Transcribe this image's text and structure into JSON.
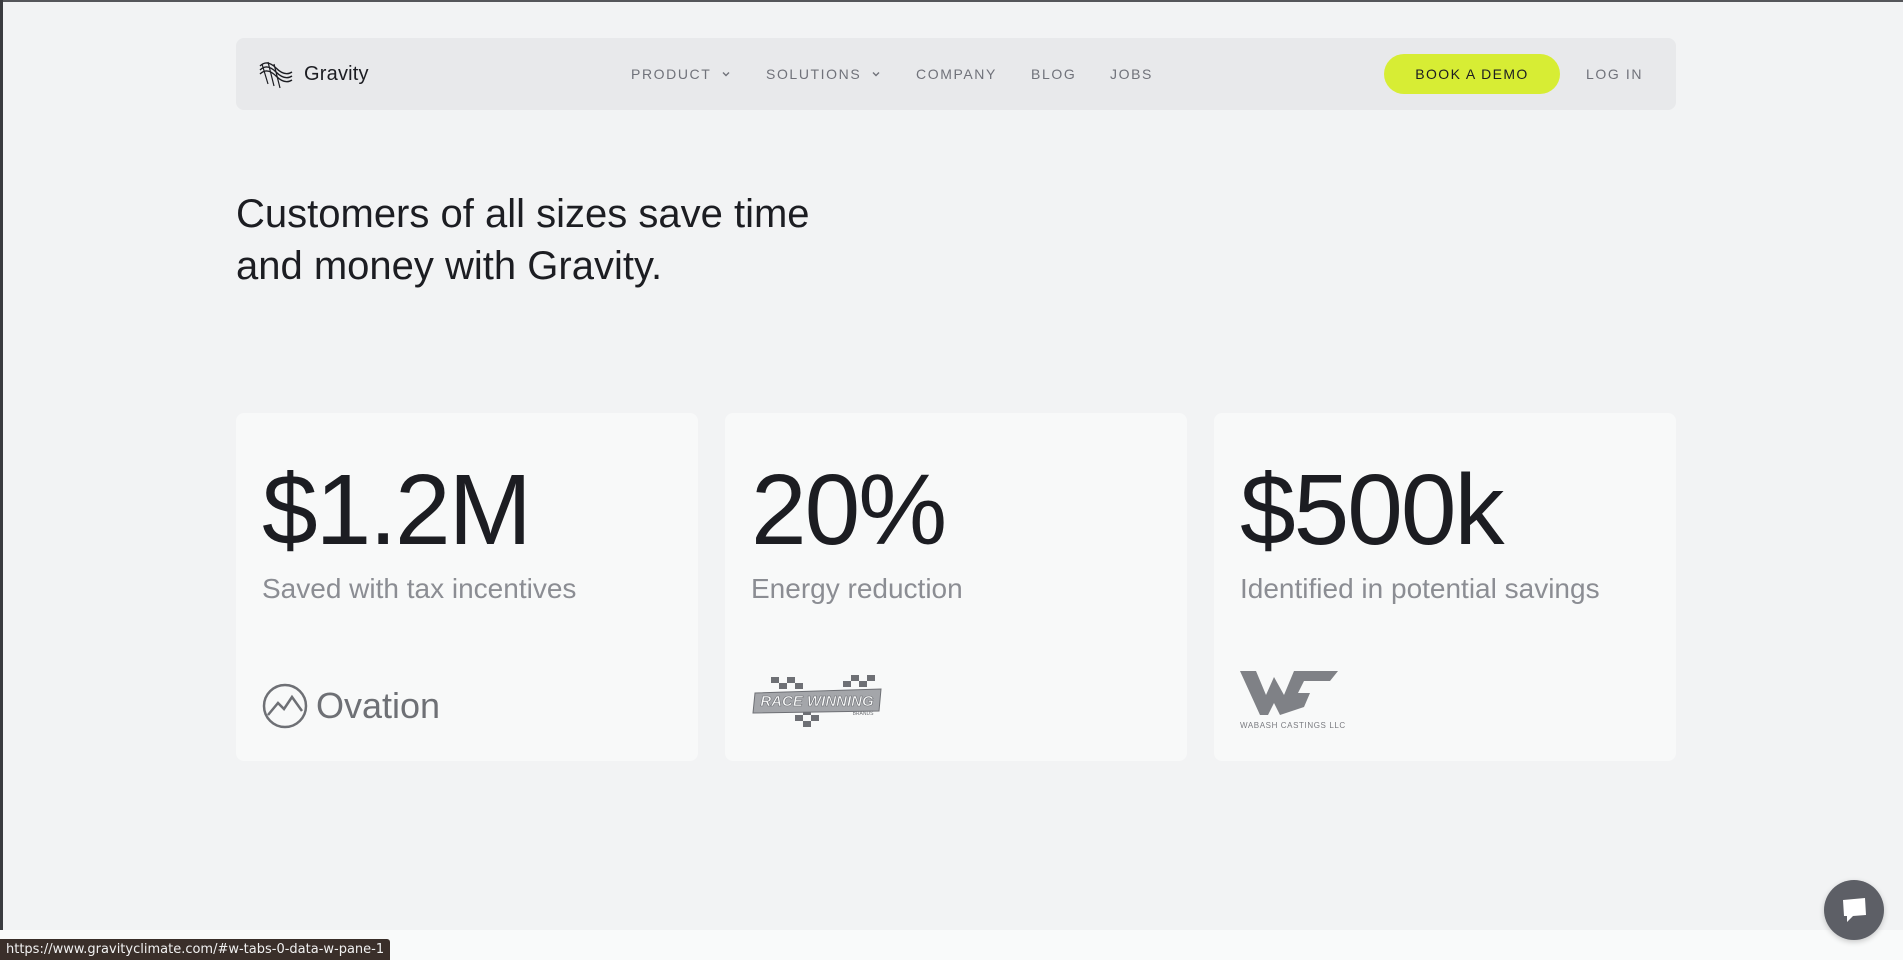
{
  "nav": {
    "brand": "Gravity",
    "items": [
      {
        "label": "PRODUCT",
        "has_dropdown": true
      },
      {
        "label": "SOLUTIONS",
        "has_dropdown": true
      },
      {
        "label": "COMPANY",
        "has_dropdown": false
      },
      {
        "label": "BLOG",
        "has_dropdown": false
      },
      {
        "label": "JOBS",
        "has_dropdown": false
      }
    ],
    "cta_label": "BOOK A DEMO",
    "login_label": "LOG IN",
    "cta_color": "#d7ed34"
  },
  "hero": {
    "line1": "Customers of all sizes save time",
    "line2": "and money with Gravity."
  },
  "cards": [
    {
      "stat": "$1.2M",
      "description": "Saved with tax incentives",
      "brand": "Ovation"
    },
    {
      "stat": "20%",
      "description": "Energy reduction",
      "brand": "RACE WINNING",
      "brand_sub": "BRANDS"
    },
    {
      "stat": "$500k",
      "description": "Identified in potential savings",
      "brand": "WABASH CASTINGS LLC"
    }
  ],
  "status_url": "https://www.gravityclimate.com/#w-tabs-0-data-w-pane-1",
  "icons": {
    "logo": "gravity-wave-icon",
    "dropdown": "chevron-down-icon",
    "chat": "chat-bubble-icon"
  }
}
